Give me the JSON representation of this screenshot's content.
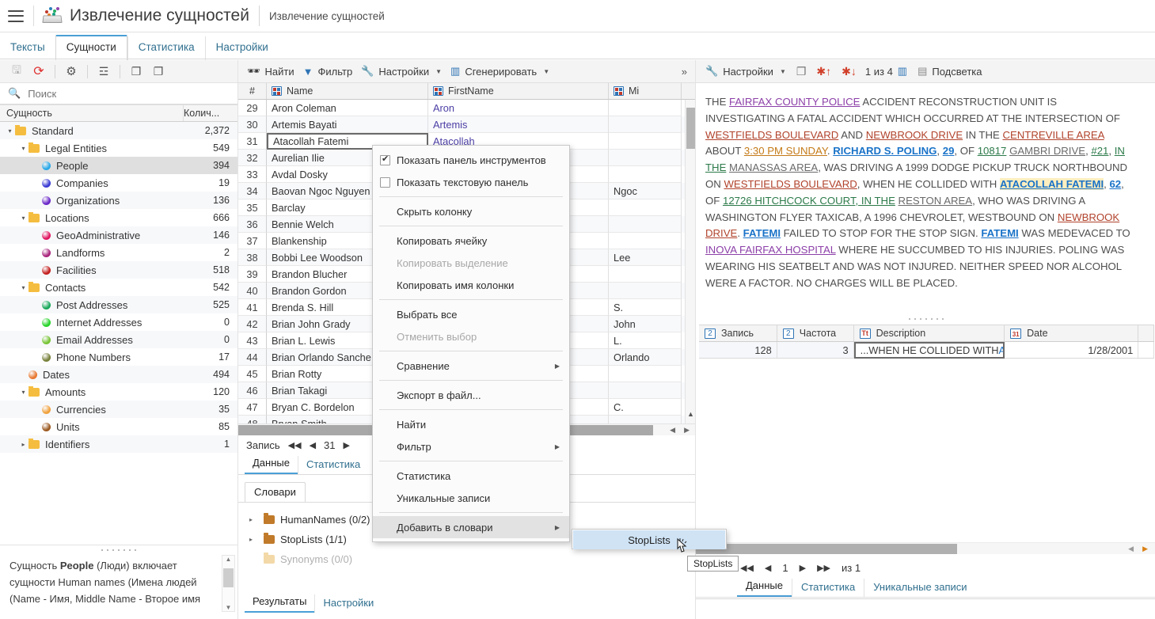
{
  "titlebar": {
    "menu_icon": "hamburger-icon",
    "logo_icon": "app-logo-icon",
    "title": "Извлечение сущностей",
    "subtitle": "Извлечение сущностей"
  },
  "main_tabs": [
    {
      "label": "Тексты",
      "active": false
    },
    {
      "label": "Сущности",
      "active": true
    },
    {
      "label": "Статистика",
      "active": false
    },
    {
      "label": "Настройки",
      "active": false
    }
  ],
  "left_panel": {
    "toolbar": [
      {
        "name": "save-button",
        "glyph": "🖫",
        "disabled": true
      },
      {
        "name": "refresh-button",
        "glyph": "⟳",
        "disabled": false
      },
      {
        "name": "settings-button",
        "glyph": "⚙",
        "disabled": false
      },
      {
        "name": "list-button",
        "glyph": "☰",
        "disabled": false
      },
      {
        "name": "expand-all-button",
        "glyph": "❐",
        "disabled": false
      },
      {
        "name": "collapse-all-button",
        "glyph": "❐",
        "disabled": false
      }
    ],
    "search": {
      "placeholder": "Поиск",
      "value": ""
    },
    "header": {
      "col1": "Сущность",
      "col2": "Колич..."
    },
    "tree": [
      {
        "label": "Standard",
        "count": "2,372",
        "indent": 0,
        "type": "folder",
        "twist": "▾",
        "selected": false
      },
      {
        "label": "Legal Entities",
        "count": "549",
        "indent": 1,
        "type": "folder",
        "twist": "▾",
        "selected": false
      },
      {
        "label": "People",
        "count": "394",
        "indent": 2,
        "type": "dot",
        "color": "#2aa9e8",
        "selected": true
      },
      {
        "label": "Companies",
        "count": "19",
        "indent": 2,
        "type": "dot",
        "color": "#3a3ad4",
        "selected": false
      },
      {
        "label": "Organizations",
        "count": "136",
        "indent": 2,
        "type": "dot",
        "color": "#6a28c8",
        "selected": false
      },
      {
        "label": "Locations",
        "count": "666",
        "indent": 1,
        "type": "folder",
        "twist": "▾",
        "selected": false
      },
      {
        "label": "GeoAdministrative",
        "count": "146",
        "indent": 2,
        "type": "dot",
        "color": "#e0145e",
        "selected": false
      },
      {
        "label": "Landforms",
        "count": "2",
        "indent": 2,
        "type": "dot",
        "color": "#a8247c",
        "selected": false
      },
      {
        "label": "Facilities",
        "count": "518",
        "indent": 2,
        "type": "dot",
        "color": "#c41f1f",
        "selected": false
      },
      {
        "label": "Contacts",
        "count": "542",
        "indent": 1,
        "type": "folder",
        "twist": "▾",
        "selected": false
      },
      {
        "label": "Post Addresses",
        "count": "525",
        "indent": 2,
        "type": "dot",
        "color": "#19a85a",
        "selected": false
      },
      {
        "label": "Internet Addresses",
        "count": "0",
        "indent": 2,
        "type": "dot",
        "color": "#27d42a",
        "selected": false
      },
      {
        "label": "Email Addresses",
        "count": "0",
        "indent": 2,
        "type": "dot",
        "color": "#77c435",
        "selected": false
      },
      {
        "label": "Phone Numbers",
        "count": "17",
        "indent": 2,
        "type": "dot",
        "color": "#77803a",
        "selected": false
      },
      {
        "label": "Dates",
        "count": "494",
        "indent": 1,
        "type": "dot",
        "color": "#e87830",
        "selected": false
      },
      {
        "label": "Amounts",
        "count": "120",
        "indent": 1,
        "type": "folder",
        "twist": "▾",
        "selected": false
      },
      {
        "label": "Currencies",
        "count": "35",
        "indent": 2,
        "type": "dot",
        "color": "#f0a13c",
        "selected": false
      },
      {
        "label": "Units",
        "count": "85",
        "indent": 2,
        "type": "dot",
        "color": "#9b5920",
        "selected": false
      },
      {
        "label": "Identifiers",
        "count": "1",
        "indent": 1,
        "type": "folder",
        "twist": "▸",
        "selected": false
      }
    ],
    "description": {
      "prefix": "Сущность ",
      "bold": "People",
      "suffix": " (Люди) включает сущности Human names (Имена людей (Name - Имя, Middle Name - Второе имя"
    }
  },
  "center_panel": {
    "toolbar": [
      {
        "label": "Найти",
        "icon": "binoculars-icon",
        "glyph": "🕮"
      },
      {
        "label": "Фильтр",
        "icon": "funnel-icon",
        "glyph": "▼"
      },
      {
        "label": "Настройки",
        "icon": "wrench-icon",
        "glyph": "🔧",
        "caret": true
      },
      {
        "label": "Сгенерировать",
        "icon": "chart-icon",
        "glyph": "📊",
        "caret": true
      }
    ],
    "overflow_label": "»",
    "grid": {
      "columns": [
        "#",
        "Name",
        "FirstName",
        "Mi"
      ],
      "rows": [
        {
          "n": "29",
          "name": "Aron Coleman",
          "first": "Aron",
          "mid": ""
        },
        {
          "n": "30",
          "name": "Artemis Bayati",
          "first": "Artemis",
          "mid": ""
        },
        {
          "n": "31",
          "name": "Atacollah Fatemi",
          "first": "Atacollah",
          "mid": "",
          "selected": true
        },
        {
          "n": "32",
          "name": "Aurelian Ilie",
          "first": "",
          "mid": ""
        },
        {
          "n": "33",
          "name": "Avdal Dosky",
          "first": "",
          "mid": ""
        },
        {
          "n": "34",
          "name": "Baovan Ngoc Nguyen",
          "first": "",
          "mid": "Ngoc"
        },
        {
          "n": "35",
          "name": "Barclay",
          "first": "",
          "mid": ""
        },
        {
          "n": "36",
          "name": "Bennie Welch",
          "first": "",
          "mid": ""
        },
        {
          "n": "37",
          "name": "Blankenship",
          "first": "",
          "mid": ""
        },
        {
          "n": "38",
          "name": "Bobbi Lee Woodson",
          "first": "",
          "mid": "Lee"
        },
        {
          "n": "39",
          "name": "Brandon Blucher",
          "first": "",
          "mid": ""
        },
        {
          "n": "40",
          "name": "Brandon Gordon",
          "first": "",
          "mid": ""
        },
        {
          "n": "41",
          "name": "Brenda S. Hill",
          "first": "",
          "mid": "S."
        },
        {
          "n": "42",
          "name": "Brian John Grady",
          "first": "",
          "mid": "John"
        },
        {
          "n": "43",
          "name": "Brian L. Lewis",
          "first": "",
          "mid": "L."
        },
        {
          "n": "44",
          "name": "Brian Orlando Sanche",
          "first": "",
          "mid": "Orlando"
        },
        {
          "n": "45",
          "name": "Brian Rotty",
          "first": "",
          "mid": ""
        },
        {
          "n": "46",
          "name": "Brian Takagi",
          "first": "",
          "mid": ""
        },
        {
          "n": "47",
          "name": "Bryan C. Bordelon",
          "first": "",
          "mid": "C."
        },
        {
          "n": "48",
          "name": "Bryan Smith",
          "first": "",
          "mid": ""
        }
      ]
    },
    "record_bar": {
      "label": "Запись",
      "value": "31",
      "first": "◀◀",
      "prev": "◀",
      "next": "▶"
    },
    "sub_tabs": [
      {
        "label": "Данные",
        "active": true
      },
      {
        "label": "Статистика",
        "active": false
      }
    ],
    "dict_tab": "Словари",
    "dictionaries": [
      {
        "label": "HumanNames (0/2)",
        "twist": "▸",
        "dim": false
      },
      {
        "label": "StopLists (1/1)",
        "twist": "▸",
        "dim": false
      },
      {
        "label": "Synonyms (0/0)",
        "twist": "",
        "dim": true
      }
    ],
    "bottom_tabs": [
      {
        "label": "Результаты",
        "active": true
      },
      {
        "label": "Настройки",
        "active": false
      }
    ]
  },
  "right_panel": {
    "toolbar": {
      "settings_label": "Настройки",
      "settings_icon": "wrench-icon",
      "note_icon": "note-icon",
      "prev_entity_icon": "asterisk-up-icon",
      "next_entity_icon": "asterisk-down-icon",
      "counter": "1 из 4",
      "chart_icon": "chart-icon",
      "doc_icon": "document-icon",
      "highlight_label": "Подсветка"
    },
    "document": {
      "tokens": [
        {
          "t": "THE ",
          "k": "plain"
        },
        {
          "t": "FAIRFAX COUNTY POLICE",
          "k": "purple"
        },
        {
          "t": " ACCIDENT RECONSTRUCTION UNIT IS INVESTIGATING A FATAL ACCIDENT WHICH OCCURRED AT THE INTERSECTION OF ",
          "k": "plain"
        },
        {
          "t": "WESTFIELDS BOULEVARD",
          "k": "red"
        },
        {
          "t": " AND ",
          "k": "plain"
        },
        {
          "t": "NEWBROOK DRIVE",
          "k": "red"
        },
        {
          "t": " IN THE ",
          "k": "plain"
        },
        {
          "t": "CENTREVILLE AREA",
          "k": "red"
        },
        {
          "t": " ABOUT ",
          "k": "plain"
        },
        {
          "t": "3:30 PM SUNDAY",
          "k": "orange"
        },
        {
          "t": ". ",
          "k": "plain"
        },
        {
          "t": "RICHARD S. POLING",
          "k": "blue"
        },
        {
          "t": ", ",
          "k": "plain"
        },
        {
          "t": "29",
          "k": "blue"
        },
        {
          "t": ", OF ",
          "k": "plain"
        },
        {
          "t": "10817",
          "k": "green"
        },
        {
          "t": " ",
          "k": "plain"
        },
        {
          "t": "GAMBRI DRIVE",
          "k": "grey"
        },
        {
          "t": ", ",
          "k": "plain"
        },
        {
          "t": "#21",
          "k": "green"
        },
        {
          "t": ", ",
          "k": "plain"
        },
        {
          "t": "IN THE",
          "k": "green"
        },
        {
          "t": " ",
          "k": "plain"
        },
        {
          "t": "MANASSAS AREA",
          "k": "grey"
        },
        {
          "t": ", WAS DRIVING A 1999 DODGE PICKUP TRUCK NORTHBOUND ON ",
          "k": "plain"
        },
        {
          "t": "WESTFIELDS BOULEVARD",
          "k": "red"
        },
        {
          "t": ", WHEN HE COLLIDED WITH ",
          "k": "plain"
        },
        {
          "t": "ATACOLLAH FATEMI",
          "k": "blue-hl"
        },
        {
          "t": ", ",
          "k": "plain"
        },
        {
          "t": "62",
          "k": "blue"
        },
        {
          "t": ", OF ",
          "k": "plain"
        },
        {
          "t": "12726 HITCHCOCK COURT, IN THE",
          "k": "green"
        },
        {
          "t": " ",
          "k": "plain"
        },
        {
          "t": "RESTON AREA",
          "k": "grey"
        },
        {
          "t": ", WHO WAS DRIVING A WASHINGTON FLYER TAXICAB, A 1996 CHEVROLET, WESTBOUND ON ",
          "k": "plain"
        },
        {
          "t": "NEWBROOK DRIVE",
          "k": "red"
        },
        {
          "t": ". ",
          "k": "plain"
        },
        {
          "t": "FATEMI",
          "k": "blue"
        },
        {
          "t": " FAILED TO STOP FOR THE STOP SIGN. ",
          "k": "plain"
        },
        {
          "t": "FATEMI",
          "k": "blue"
        },
        {
          "t": " WAS MEDEVACED TO ",
          "k": "plain"
        },
        {
          "t": "INOVA FAIRFAX HOSPITAL",
          "k": "purple"
        },
        {
          "t": " WHERE HE SUCCUMBED TO HIS INJURIES. POLING WAS WEARING HIS SEATBELT AND WAS NOT INJURED. NEITHER SPEED NOR ALCOHOL WERE A FACTOR. NO CHARGES WILL BE PLACED.",
          "k": "plain"
        }
      ]
    },
    "table": {
      "columns": [
        {
          "label": "Запись",
          "icon": "number-column-icon",
          "glyph": "2"
        },
        {
          "label": "Частота",
          "icon": "number-column-icon",
          "glyph": "2"
        },
        {
          "label": "Description",
          "icon": "text-column-icon",
          "glyph": "Tt"
        },
        {
          "label": "Date",
          "icon": "date-column-icon",
          "glyph": "31"
        }
      ],
      "row": {
        "record": "128",
        "frequency": "3",
        "description_prefix": "...WHEN HE COLLIDED WITH ",
        "description_link": "ATAC",
        "date": "1/28/2001"
      }
    },
    "pager": {
      "first": "◀◀",
      "prev": "◀",
      "page": "1",
      "next": "▶",
      "last": "▶▶",
      "of": "из 1"
    },
    "bottom_tabs": [
      {
        "label": "Данные",
        "active": true
      },
      {
        "label": "Статистика",
        "active": false
      },
      {
        "label": "Уникальные записи",
        "active": false
      }
    ]
  },
  "context_menu": {
    "items": [
      {
        "label": "Показать панель инструментов",
        "type": "checkbox",
        "checked": true
      },
      {
        "label": "Показать текстовую панель",
        "type": "checkbox",
        "checked": false
      },
      {
        "type": "separator"
      },
      {
        "label": "Скрыть колонку",
        "type": "item"
      },
      {
        "type": "separator"
      },
      {
        "label": "Копировать ячейку",
        "type": "item"
      },
      {
        "label": "Копировать выделение",
        "type": "item",
        "disabled": true
      },
      {
        "label": "Копировать имя колонки",
        "type": "item"
      },
      {
        "type": "separator"
      },
      {
        "label": "Выбрать все",
        "type": "item"
      },
      {
        "label": "Отменить выбор",
        "type": "item",
        "disabled": true
      },
      {
        "type": "separator"
      },
      {
        "label": "Сравнение",
        "type": "item",
        "submenu": true
      },
      {
        "type": "separator"
      },
      {
        "label": "Экспорт в файл...",
        "type": "item"
      },
      {
        "type": "separator"
      },
      {
        "label": "Найти",
        "type": "item"
      },
      {
        "label": "Фильтр",
        "type": "item",
        "submenu": true
      },
      {
        "type": "separator"
      },
      {
        "label": "Статистика",
        "type": "item"
      },
      {
        "label": "Уникальные записи",
        "type": "item"
      },
      {
        "type": "separator"
      },
      {
        "label": "Добавить в словари",
        "type": "item",
        "submenu": true,
        "highlighted": true
      }
    ],
    "submenu_item": "StopLists",
    "tooltip": "StopLists"
  }
}
